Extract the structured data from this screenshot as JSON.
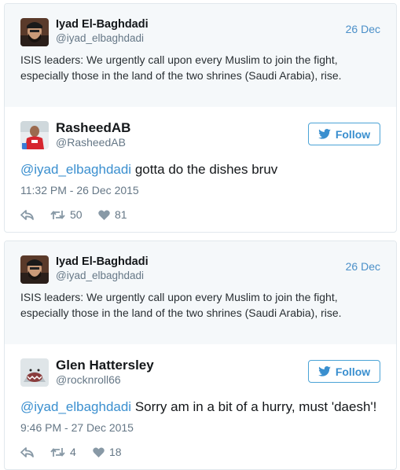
{
  "tweets": [
    {
      "quoted": {
        "name": "Iyad El-Baghdadi",
        "handle": "@iyad_elbaghdadi",
        "date": "26 Dec",
        "text": "ISIS leaders: We urgently call upon every Muslim to join the fight, especially those in the land of the two shrines (Saudi Arabia), rise."
      },
      "reply": {
        "name": "RasheedAB",
        "handle": "@RasheedAB",
        "follow_label": "Follow",
        "mention": "@iyad_elbaghdadi",
        "text": " gotta do the dishes bruv",
        "timestamp": "11:32 PM - 26 Dec 2015",
        "retweets": "50",
        "likes": "81"
      }
    },
    {
      "quoted": {
        "name": "Iyad El-Baghdadi",
        "handle": "@iyad_elbaghdadi",
        "date": "26 Dec",
        "text": "ISIS leaders: We urgently call upon every Muslim to join the fight, especially those in the land of the two shrines (Saudi Arabia), rise."
      },
      "reply": {
        "name": "Glen Hattersley",
        "handle": "@rocknroll66",
        "follow_label": "Follow",
        "mention": "@iyad_elbaghdadi",
        "text": " Sorry am in a bit of a hurry, must 'daesh'!",
        "timestamp": "9:46 PM - 27 Dec 2015",
        "retweets": "4",
        "likes": "18"
      }
    }
  ],
  "icons": {
    "reply": "reply-icon",
    "retweet": "retweet-icon",
    "like": "heart-icon",
    "follow": "twitter-bird-icon"
  },
  "colors": {
    "link": "#3a8fcf",
    "muted": "#657786",
    "quoted_bg": "#f5f8fa",
    "border": "#e1e8ed"
  }
}
